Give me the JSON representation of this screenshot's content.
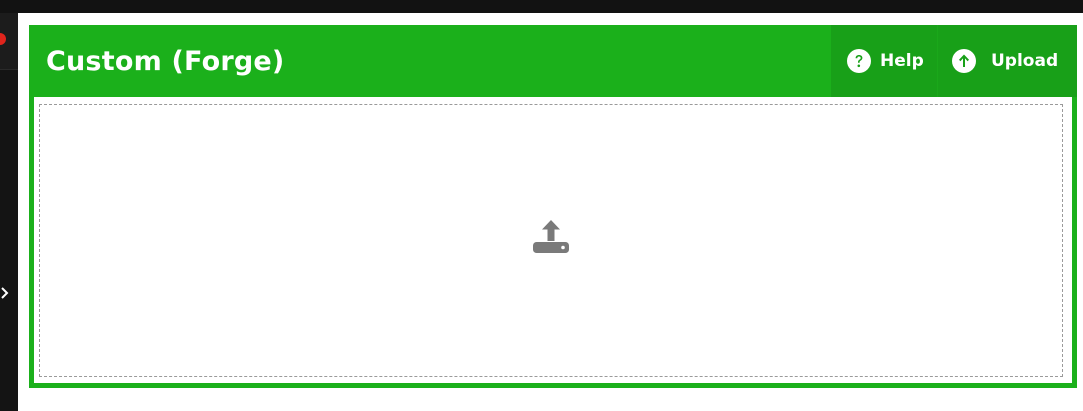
{
  "panel": {
    "title": "Custom (Forge)",
    "help_label": "Help",
    "upload_label": "Upload"
  },
  "icons": {
    "help": "question-circle-icon",
    "upload": "arrow-up-circle-icon",
    "dropzone": "tray-upload-icon",
    "sidebar_toggle": "chevron-right-icon"
  },
  "colors": {
    "accent": "#1bb01b",
    "button_bg": "#18a018",
    "dropzone_icon": "#7a7a7a"
  }
}
